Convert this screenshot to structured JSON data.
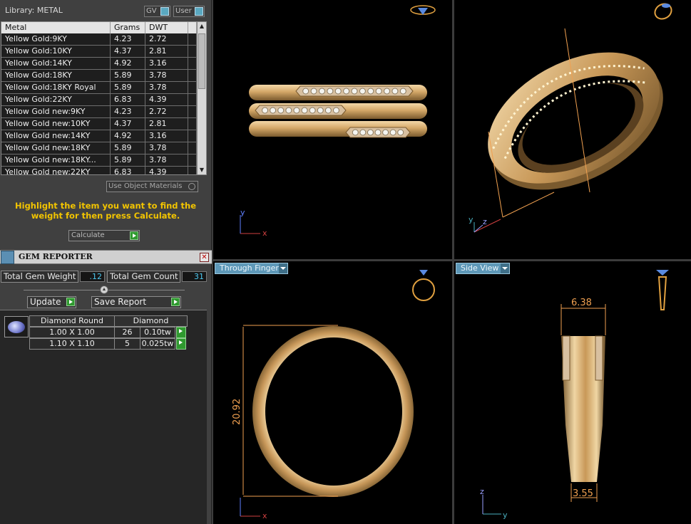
{
  "library": {
    "title": "Library: METAL",
    "gv_label": "GV",
    "user_label": "User"
  },
  "metal_table": {
    "columns": [
      "Metal",
      "Grams",
      "DWT"
    ],
    "rows": [
      [
        "Yellow Gold:9KY",
        "4.23",
        "2.72"
      ],
      [
        "Yellow Gold:10KY",
        "4.37",
        "2.81"
      ],
      [
        "Yellow Gold:14KY",
        "4.92",
        "3.16"
      ],
      [
        "Yellow Gold:18KY",
        "5.89",
        "3.78"
      ],
      [
        "Yellow Gold:18KY Royal",
        "5.89",
        "3.78"
      ],
      [
        "Yellow Gold:22KY",
        "6.83",
        "4.39"
      ],
      [
        "Yellow Gold new:9KY",
        "4.23",
        "2.72"
      ],
      [
        "Yellow Gold new:10KY",
        "4.37",
        "2.81"
      ],
      [
        "Yellow Gold new:14KY",
        "4.92",
        "3.16"
      ],
      [
        "Yellow Gold new:18KY",
        "5.89",
        "3.78"
      ],
      [
        "Yellow Gold new:18KY...",
        "5.89",
        "3.78"
      ],
      [
        "Yellow Gold new:22KY",
        "6.83",
        "4.39"
      ]
    ]
  },
  "use_object_materials": "Use Object Materials",
  "hint": "Highlight the item you want to find the weight for then press Calculate.",
  "calculate_label": "Calculate",
  "gem_reporter": {
    "title": "GEM REPORTER",
    "total_weight_label": "Total Gem Weight",
    "total_weight_value": ".12",
    "total_count_label": "Total Gem Count",
    "total_count_value": "31",
    "update_label": "Update",
    "save_report_label": "Save Report",
    "gem_header": [
      "Diamond Round",
      "Diamond"
    ],
    "gem_rows": [
      [
        "1.00 X 1.00",
        "26",
        "0.10tw"
      ],
      [
        "1.10 X 1.10",
        "5",
        "0.025tw"
      ]
    ]
  },
  "viewports": {
    "bottom_left_view": "Through Finger",
    "bottom_right_view": "Side View",
    "axis": {
      "x": "x",
      "y": "y",
      "z": "z"
    },
    "dim_diameter": "20.92",
    "dim_top_width": "6.38",
    "dim_bottom_width": "3.55"
  },
  "colors": {
    "gold": "#d9b27a",
    "gold_dark": "#8a6838",
    "dimension_orange": "#f0a050",
    "accent_blue": "#5e98b8",
    "hint_yellow": "#f2c400"
  }
}
